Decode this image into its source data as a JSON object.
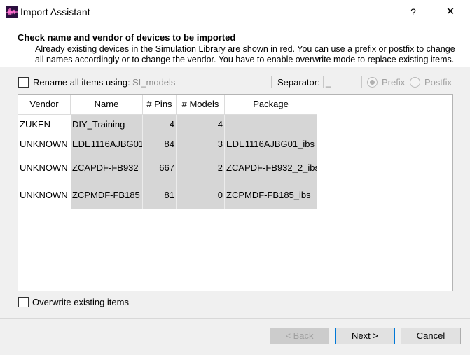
{
  "window": {
    "title": "Import Assistant",
    "help_label": "?",
    "close_label": "✕"
  },
  "header": {
    "title": "Check name and vendor of devices to be imported",
    "description": "Already existing devices in the Simulation Library are shown in red. You can use a prefix or postfix to change all names accordingly or to change the vendor. You have to enable overwrite mode to replace existing items."
  },
  "rename": {
    "checkbox_label": "Rename all items using:",
    "checked": false,
    "name_value": "SI_models",
    "separator_label": "Separator:",
    "separator_value": "_",
    "prefix_label": "Prefix",
    "postfix_label": "Postfix",
    "selected": "Prefix"
  },
  "table": {
    "columns": [
      "Vendor",
      "Name",
      "# Pins",
      "# Models",
      "Package"
    ],
    "rows": [
      {
        "vendor": "ZUKEN",
        "name": "DIY_Training",
        "pins": "4",
        "models": "4",
        "package": ""
      },
      {
        "vendor": "UNKNOWN",
        "name": "EDE1116AJBG01",
        "pins": "84",
        "models": "3",
        "package": "EDE1116AJBG01_ibs"
      },
      {
        "vendor": "UNKNOWN",
        "name": "ZCAPDF-FB932",
        "pins": "667",
        "models": "2",
        "package": "ZCAPDF-FB932_2_ibs"
      },
      {
        "vendor": "UNKNOWN",
        "name": "ZCPMDF-FB185",
        "pins": "81",
        "models": "0",
        "package": "ZCPMDF-FB185_ibs"
      }
    ]
  },
  "overwrite": {
    "label": "Overwrite existing items",
    "checked": false
  },
  "buttons": {
    "back": "< Back",
    "next": "Next >",
    "cancel": "Cancel"
  },
  "colors": {
    "app_icon_bg": "#2a0f3e",
    "app_icon_wave": "#ff6fd0",
    "default_button_border": "#0078d7",
    "row_shade": "#d6d6d6"
  },
  "icons": {
    "app": "waveform-icon",
    "close": "close-icon"
  }
}
